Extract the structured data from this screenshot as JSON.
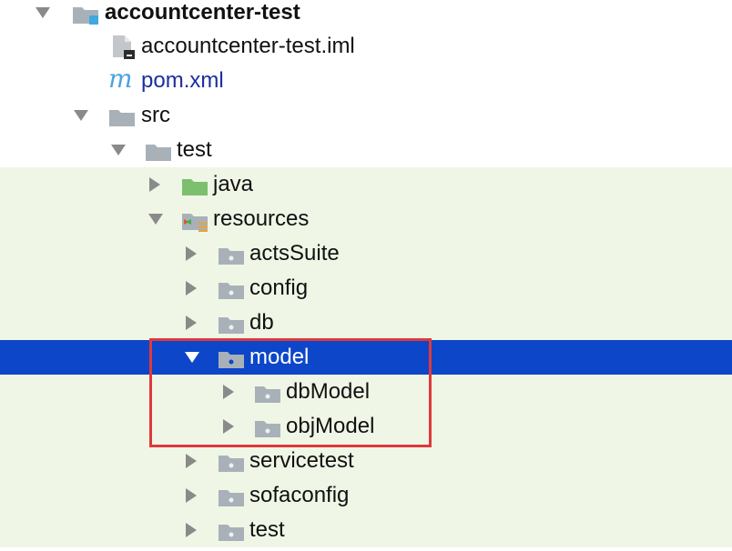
{
  "project": {
    "name": "accountcenter-test",
    "files": [
      {
        "label": "accountcenter-test.iml",
        "icon": "iml-file-icon"
      },
      {
        "label": "pom.xml",
        "icon": "maven-icon"
      }
    ]
  },
  "tree": {
    "src": "src",
    "test": "test",
    "java": "java",
    "resources": "resources",
    "resource_folders": {
      "actsSuite": "actsSuite",
      "config": "config",
      "db": "db",
      "model": "model",
      "dbModel": "dbModel",
      "objModel": "objModel",
      "servicetest": "servicetest",
      "sofaconfig": "sofaconfig",
      "test": "test"
    },
    "selected": "model"
  },
  "colors": {
    "selection": "#0d46c9",
    "test_background": "#eff6e6",
    "highlight_border": "#e0393b",
    "folder": "#a9b1b8",
    "source_folder": "#7cc06e",
    "module_badge": "#3fa9e0"
  }
}
